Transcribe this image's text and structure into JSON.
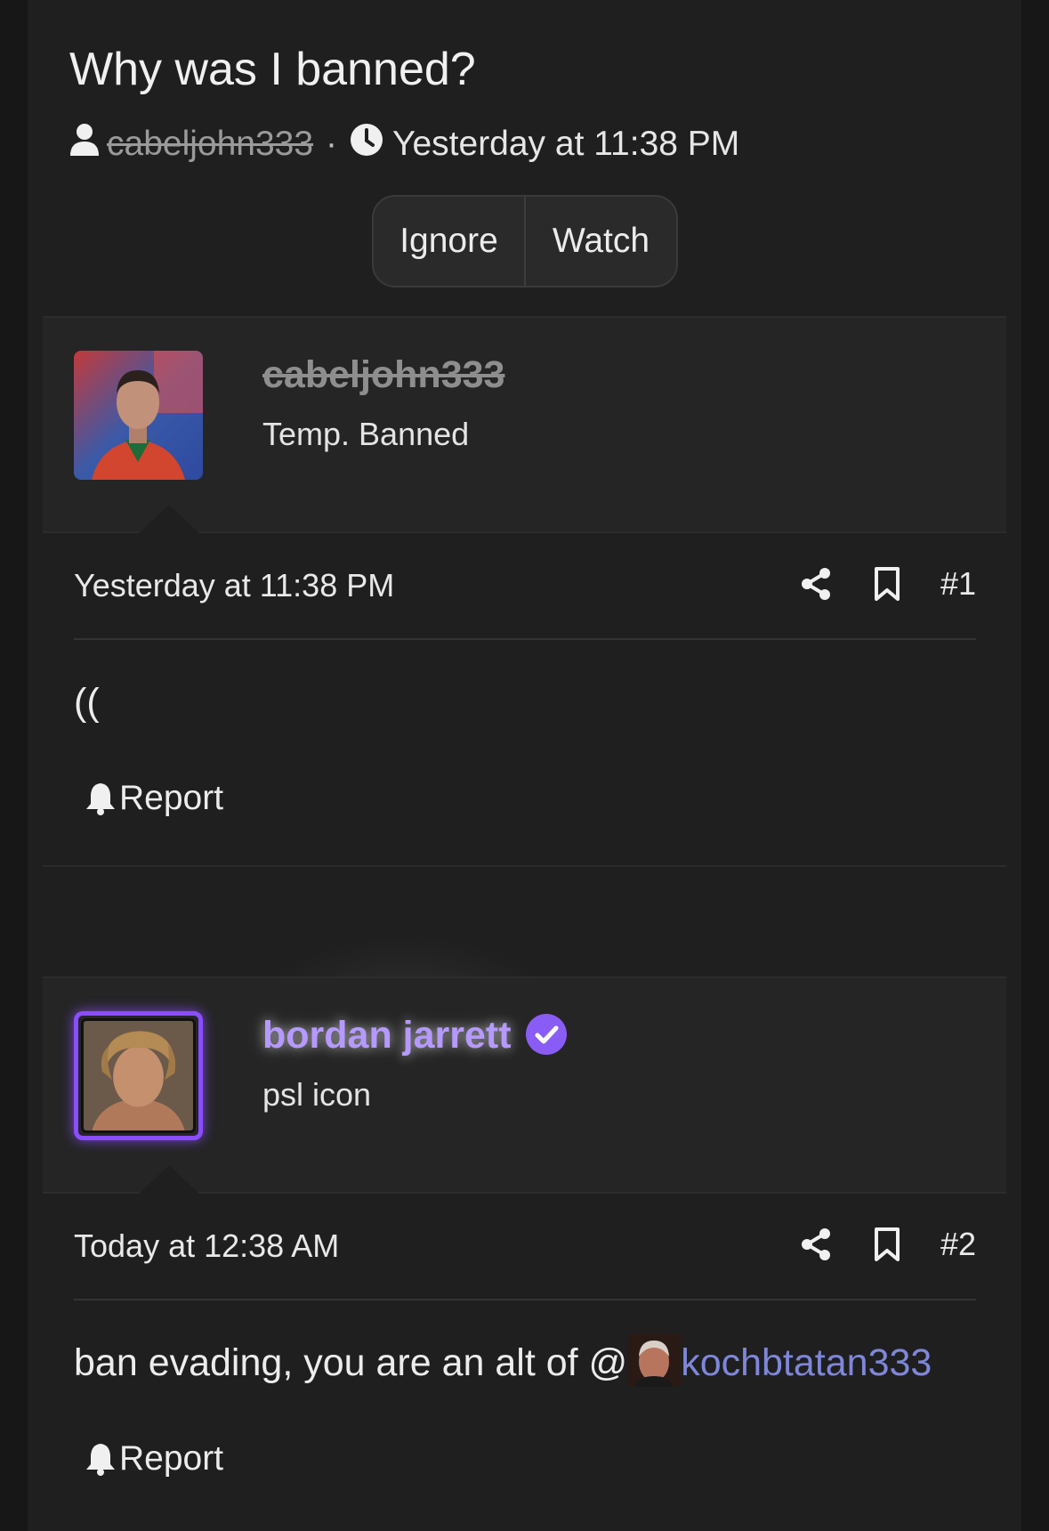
{
  "thread": {
    "title": "Why was I banned?",
    "author": "cabeljohn333",
    "separator": "·",
    "date": "Yesterday at 11:38 PM",
    "ignore_label": "Ignore",
    "watch_label": "Watch"
  },
  "posts": [
    {
      "username": "cabeljohn333",
      "user_title": "Temp. Banned",
      "date": "Yesterday at 11:38 PM",
      "number": "#1",
      "body": "((",
      "report_label": "Report"
    },
    {
      "username": "bordan jarrett",
      "user_title": "psl icon",
      "date": "Today at 12:38 AM",
      "number": "#2",
      "body_prefix": "ban evading, you are an alt of @",
      "mention": "kochbtatan333",
      "report_label": "Report"
    }
  ],
  "colors": {
    "background": "#1f1f1f",
    "card": "#252525",
    "mention": "#7f87d9",
    "verified": "#8a5cf6",
    "username_glow": "#b599ff",
    "banned_name": "#8e8e8e"
  },
  "icons": [
    "user-icon",
    "clock-icon",
    "share-icon",
    "bookmark-icon",
    "bell-icon",
    "verified-badge-icon"
  ]
}
